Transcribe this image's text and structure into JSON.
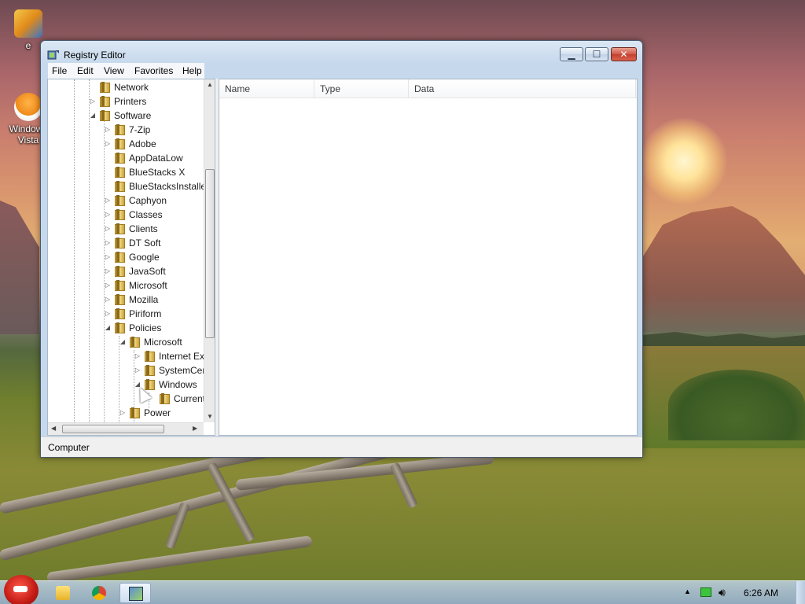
{
  "desktop": {
    "icons": [
      {
        "label": "e",
        "icon": "file-icon"
      },
      {
        "label": "Windows Vista",
        "icon": "egg-icon"
      }
    ]
  },
  "window": {
    "title": "Registry Editor",
    "buttons": {
      "minimize": "▁",
      "maximize": "☐",
      "close": "✕"
    },
    "menu": [
      "File",
      "Edit",
      "View",
      "Favorites",
      "Help"
    ]
  },
  "tree": {
    "items": [
      {
        "label": "Network",
        "indent": 3,
        "expander": "",
        "collapsed": false
      },
      {
        "label": "Printers",
        "indent": 3,
        "expander": "▷",
        "collapsed": true
      },
      {
        "label": "Software",
        "indent": 3,
        "expander": "◢",
        "collapsed": false
      },
      {
        "label": "7-Zip",
        "indent": 4,
        "expander": "▷",
        "collapsed": true
      },
      {
        "label": "Adobe",
        "indent": 4,
        "expander": "▷",
        "collapsed": true
      },
      {
        "label": "AppDataLow",
        "indent": 4,
        "expander": "",
        "collapsed": false
      },
      {
        "label": "BlueStacks X",
        "indent": 4,
        "expander": "",
        "collapsed": false
      },
      {
        "label": "BlueStacksInstaller",
        "indent": 4,
        "expander": "",
        "collapsed": false
      },
      {
        "label": "Caphyon",
        "indent": 4,
        "expander": "▷",
        "collapsed": true
      },
      {
        "label": "Classes",
        "indent": 4,
        "expander": "▷",
        "collapsed": true
      },
      {
        "label": "Clients",
        "indent": 4,
        "expander": "▷",
        "collapsed": true
      },
      {
        "label": "DT Soft",
        "indent": 4,
        "expander": "▷",
        "collapsed": true
      },
      {
        "label": "Google",
        "indent": 4,
        "expander": "▷",
        "collapsed": true
      },
      {
        "label": "JavaSoft",
        "indent": 4,
        "expander": "▷",
        "collapsed": true
      },
      {
        "label": "Microsoft",
        "indent": 4,
        "expander": "▷",
        "collapsed": true
      },
      {
        "label": "Mozilla",
        "indent": 4,
        "expander": "▷",
        "collapsed": true
      },
      {
        "label": "Piriform",
        "indent": 4,
        "expander": "▷",
        "collapsed": true
      },
      {
        "label": "Policies",
        "indent": 4,
        "expander": "◢",
        "collapsed": false
      },
      {
        "label": "Microsoft",
        "indent": 5,
        "expander": "◢",
        "collapsed": false
      },
      {
        "label": "Internet Exp",
        "indent": 6,
        "expander": "▷",
        "collapsed": true
      },
      {
        "label": "SystemCer",
        "indent": 6,
        "expander": "▷",
        "collapsed": true
      },
      {
        "label": "Windows",
        "indent": 6,
        "expander": "◢",
        "collapsed": false
      },
      {
        "label": "Current",
        "indent": 7,
        "expander": "",
        "collapsed": false
      },
      {
        "label": "Power",
        "indent": 5,
        "expander": "▷",
        "collapsed": true
      }
    ]
  },
  "list": {
    "columns": [
      "Name",
      "Type",
      "Data"
    ]
  },
  "status": {
    "path": "Computer"
  },
  "taskbar": {
    "clock": "6:26 AM",
    "apps": [
      "folder-icon",
      "chrome-icon",
      "regedit-icon"
    ]
  }
}
